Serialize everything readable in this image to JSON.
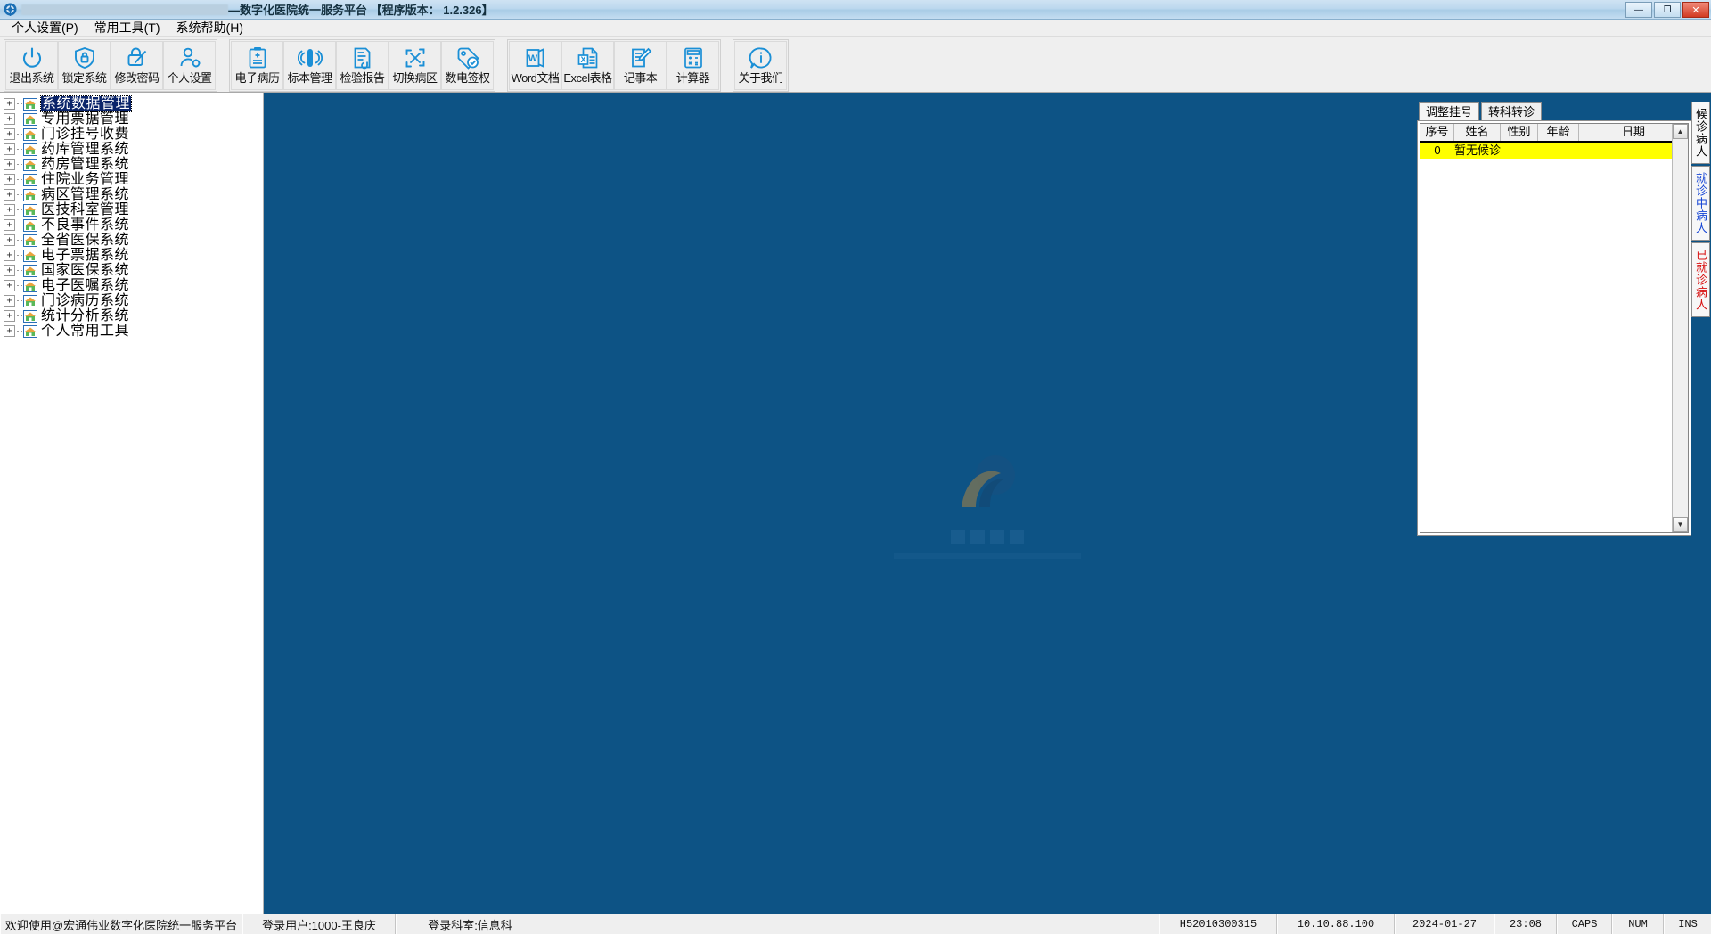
{
  "window": {
    "title_suffix": "—数字化医院统一服务平台 【程序版本： 1.2.326】",
    "title_redacted": true,
    "buttons": {
      "minimize": "—",
      "maximize": "❐",
      "close": "✕"
    }
  },
  "menubar": [
    {
      "label": "个人设置(P)",
      "key": "P"
    },
    {
      "label": "常用工具(T)",
      "key": "T"
    },
    {
      "label": "系统帮助(H)",
      "key": "H"
    }
  ],
  "toolbar": {
    "groups": [
      {
        "buttons": [
          {
            "label": "退出系统",
            "icon": "power-icon"
          },
          {
            "label": "锁定系统",
            "icon": "shield-lock-icon"
          },
          {
            "label": "修改密码",
            "icon": "password-edit-icon"
          },
          {
            "label": "个人设置",
            "icon": "user-settings-icon"
          }
        ]
      },
      {
        "buttons": [
          {
            "label": "电子病历",
            "icon": "clipboard-plus-icon"
          },
          {
            "label": "标本管理",
            "icon": "test-tube-icon"
          },
          {
            "label": "检验报告",
            "icon": "report-check-icon"
          },
          {
            "label": "切换病区",
            "icon": "switch-ward-icon"
          },
          {
            "label": "数电签权",
            "icon": "e-signature-tag-icon"
          }
        ]
      },
      {
        "buttons": [
          {
            "label": "Word文档",
            "icon": "word-icon"
          },
          {
            "label": "Excel表格",
            "icon": "excel-icon"
          },
          {
            "label": "记事本",
            "icon": "notepad-icon"
          },
          {
            "label": "计算器",
            "icon": "calculator-icon"
          }
        ]
      },
      {
        "buttons": [
          {
            "label": "关于我们",
            "icon": "info-icon"
          }
        ]
      }
    ]
  },
  "tree": {
    "items": [
      {
        "label": "系统数据管理",
        "selected": true
      },
      {
        "label": "专用票据管理",
        "selected": false
      },
      {
        "label": "门诊挂号收费",
        "selected": false
      },
      {
        "label": "药库管理系统",
        "selected": false
      },
      {
        "label": "药房管理系统",
        "selected": false
      },
      {
        "label": "住院业务管理",
        "selected": false
      },
      {
        "label": "病区管理系统",
        "selected": false
      },
      {
        "label": "医技科室管理",
        "selected": false
      },
      {
        "label": "不良事件系统",
        "selected": false
      },
      {
        "label": "全省医保系统",
        "selected": false
      },
      {
        "label": "电子票据系统",
        "selected": false
      },
      {
        "label": "国家医保系统",
        "selected": false
      },
      {
        "label": "电子医嘱系统",
        "selected": false
      },
      {
        "label": "门诊病历系统",
        "selected": false
      },
      {
        "label": "统计分析系统",
        "selected": false
      },
      {
        "label": "个人常用工具",
        "selected": false
      }
    ],
    "expander": "+"
  },
  "patient_panel": {
    "tabs": [
      {
        "label": "调整挂号",
        "active": true
      },
      {
        "label": "转科转诊",
        "active": false
      }
    ],
    "columns": [
      "序号",
      "姓名",
      "性别",
      "年龄",
      "日期"
    ],
    "rows": [
      {
        "序号": "0",
        "姓名": "暂无候诊",
        "性别": "",
        "年龄": "",
        "日期": ""
      }
    ],
    "scroll_up": "▲",
    "scroll_down": "▼"
  },
  "side_tabs": [
    {
      "label": "候诊病人",
      "color": "#000000"
    },
    {
      "label": "就诊中病人",
      "color": "#1746d6"
    },
    {
      "label": "已就诊病人",
      "color": "#d81010"
    }
  ],
  "statusbar": {
    "welcome": "欢迎使用@宏通伟业数字化医院统一服务平台",
    "user": "登录用户:1000-王良庆",
    "department": "登录科室:信息科",
    "org_code": "H52010300315",
    "ip": "10.10.88.100",
    "date": "2024-01-27",
    "time": "23:08",
    "caps": "CAPS",
    "num": "NUM",
    "ins": "INS"
  },
  "colors": {
    "desktop_blue": "#0d5385",
    "selection_blue": "#0a246a",
    "highlight_yellow": "#ffff00",
    "icon_blue": "#1a8fd6",
    "titlebar": "#bcd8ee"
  }
}
